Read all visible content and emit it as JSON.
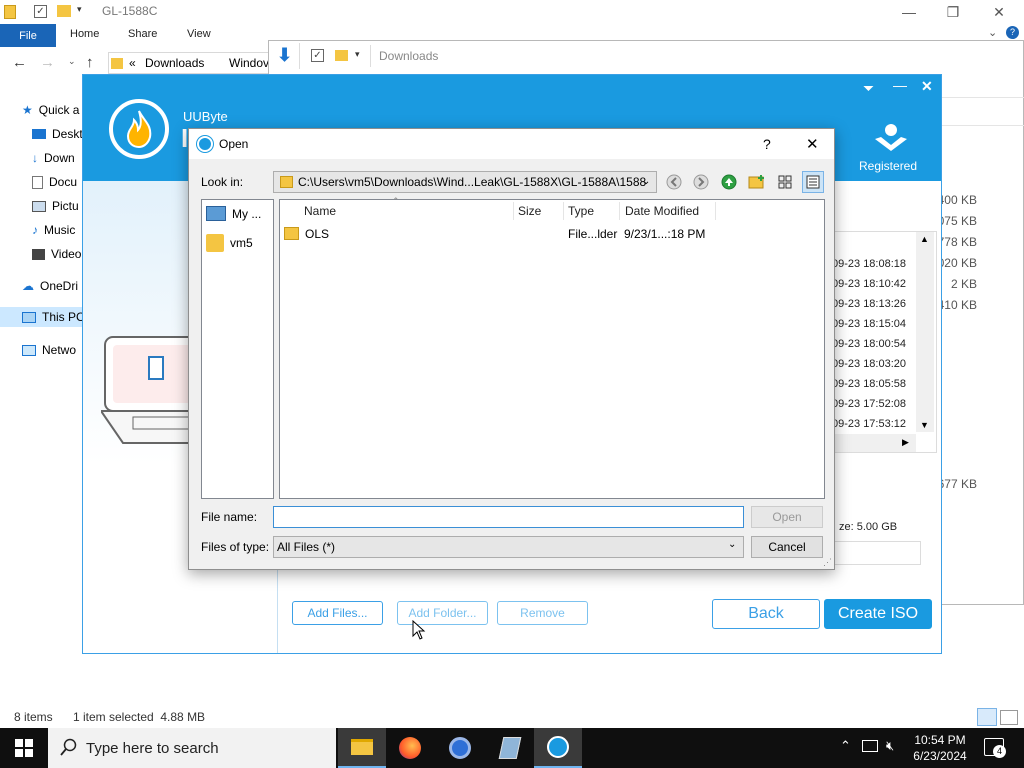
{
  "explorer": {
    "title": "GL-1588C",
    "ribbon_tabs": [
      "File",
      "Home",
      "Share",
      "View"
    ],
    "breadcrumb_sep": "«",
    "breadcrumb": [
      "Downloads",
      "Windov"
    ],
    "nav_items": [
      "Quick a",
      "Deskt",
      "Down",
      "Docu",
      "Pictu",
      "Music",
      "Video",
      "OneDri",
      "This PC",
      "Netwo"
    ],
    "status_count": "8 items",
    "status_selected": "1 item selected  4.88 MB"
  },
  "explorer2": {
    "title": "Downloads",
    "sizes": [
      "400 KB",
      "075 KB",
      "778 KB",
      "020 KB",
      "2 KB",
      "410 KB",
      "677 KB"
    ]
  },
  "uubyte": {
    "brand": "UUByte",
    "brand2": "I",
    "registered": "Registered",
    "dates": [
      "09-23 18:08:18",
      "09-23 18:10:42",
      "09-23 18:13:26",
      "09-23 18:15:04",
      "09-23 18:00:54",
      "09-23 18:03:20",
      "09-23 18:05:58",
      "09-23 17:52:08",
      "09-23 17:53:12"
    ],
    "size_info": "ze: 5.00 GB",
    "buttons": {
      "add_files": "Add Files...",
      "add_folder": "Add Folder...",
      "remove": "Remove",
      "back": "Back",
      "create_iso": "Create ISO"
    }
  },
  "dialog": {
    "title": "Open",
    "help": "?",
    "close": "✕",
    "look_in_label": "Look in:",
    "look_in_value": "C:\\Users\\vm5\\Downloads\\Wind...Leak\\GL-1588X\\GL-1588A\\1588",
    "places": [
      "My ...",
      "vm5"
    ],
    "columns": {
      "name": "Name",
      "size": "Size",
      "type": "Type",
      "date": "Date Modified"
    },
    "rows": [
      {
        "name": "OLS",
        "size": "",
        "type": "File...lder",
        "date": "9/23/1...:18 PM"
      }
    ],
    "file_name_label": "File name:",
    "file_name_value": "",
    "files_of_type_label": "Files of type:",
    "files_of_type_value": "All Files (*)",
    "open_button": "Open",
    "cancel_button": "Cancel"
  },
  "taskbar": {
    "search_placeholder": "Type here to search",
    "time": "10:54 PM",
    "date": "6/23/2024",
    "notification_count": "4"
  }
}
